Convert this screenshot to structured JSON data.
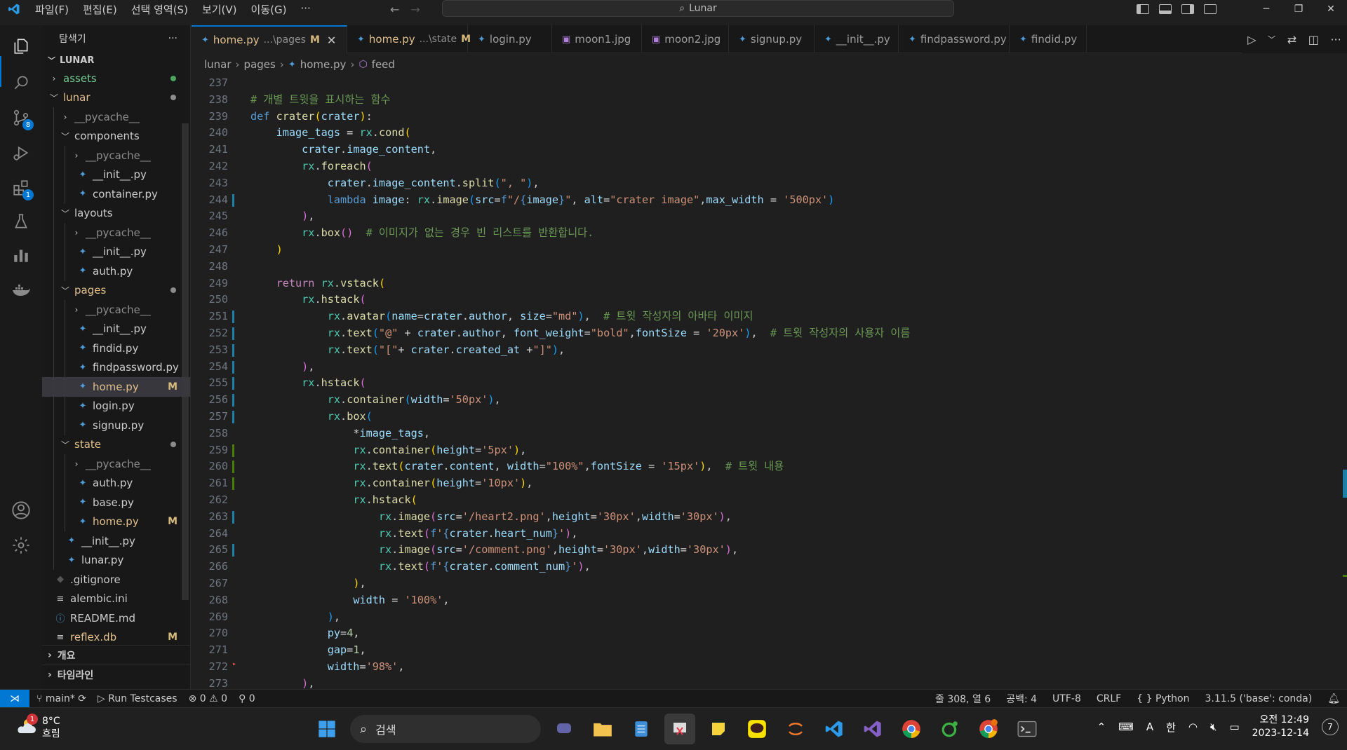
{
  "titlebar": {
    "menu": [
      "파일(F)",
      "편집(E)",
      "선택 영역(S)",
      "보기(V)",
      "이동(G)",
      "···"
    ],
    "search_text": "Lunar"
  },
  "activity": {
    "scm_badge": "8",
    "ext_badge": "1"
  },
  "sidebar": {
    "header": "탐색기",
    "more": "···",
    "root": "LUNAR",
    "items": [
      {
        "label": "assets",
        "indent": 0,
        "type": "folder",
        "open": false,
        "dot": "#4ea35b",
        "color": "#73c991"
      },
      {
        "label": "lunar",
        "indent": 0,
        "type": "folder",
        "open": true,
        "dot": "#8c8c8c",
        "color": "#e2c08d"
      },
      {
        "label": "__pycache__",
        "indent": 1,
        "type": "folder",
        "open": false,
        "color": "#8c8c8c"
      },
      {
        "label": "components",
        "indent": 1,
        "type": "folder",
        "open": true,
        "color": "#cccccc"
      },
      {
        "label": "__pycache__",
        "indent": 2,
        "type": "folder",
        "open": false,
        "color": "#8c8c8c"
      },
      {
        "label": "__init__.py",
        "indent": 2,
        "type": "file",
        "color": "#cccccc"
      },
      {
        "label": "container.py",
        "indent": 2,
        "type": "file",
        "color": "#cccccc"
      },
      {
        "label": "layouts",
        "indent": 1,
        "type": "folder",
        "open": true,
        "color": "#cccccc"
      },
      {
        "label": "__pycache__",
        "indent": 2,
        "type": "folder",
        "open": false,
        "color": "#8c8c8c"
      },
      {
        "label": "__init__.py",
        "indent": 2,
        "type": "file",
        "color": "#cccccc"
      },
      {
        "label": "auth.py",
        "indent": 2,
        "type": "file",
        "color": "#cccccc"
      },
      {
        "label": "pages",
        "indent": 1,
        "type": "folder",
        "open": true,
        "dot": "#8c8c8c",
        "color": "#e2c08d"
      },
      {
        "label": "__pycache__",
        "indent": 2,
        "type": "folder",
        "open": false,
        "color": "#8c8c8c"
      },
      {
        "label": "__init__.py",
        "indent": 2,
        "type": "file",
        "color": "#cccccc"
      },
      {
        "label": "findid.py",
        "indent": 2,
        "type": "file",
        "color": "#cccccc"
      },
      {
        "label": "findpassword.py",
        "indent": 2,
        "type": "file",
        "color": "#cccccc"
      },
      {
        "label": "home.py",
        "indent": 2,
        "type": "file",
        "badge": "M",
        "selected": true,
        "color": "#e2c08d"
      },
      {
        "label": "login.py",
        "indent": 2,
        "type": "file",
        "color": "#cccccc"
      },
      {
        "label": "signup.py",
        "indent": 2,
        "type": "file",
        "color": "#cccccc"
      },
      {
        "label": "state",
        "indent": 1,
        "type": "folder",
        "open": true,
        "dot": "#8c8c8c",
        "color": "#e2c08d"
      },
      {
        "label": "__pycache__",
        "indent": 2,
        "type": "folder",
        "open": false,
        "color": "#8c8c8c"
      },
      {
        "label": "auth.py",
        "indent": 2,
        "type": "file",
        "color": "#cccccc"
      },
      {
        "label": "base.py",
        "indent": 2,
        "type": "file",
        "color": "#cccccc"
      },
      {
        "label": "home.py",
        "indent": 2,
        "type": "file",
        "badge": "M",
        "color": "#e2c08d"
      },
      {
        "label": "__init__.py",
        "indent": 1,
        "type": "file",
        "color": "#cccccc"
      },
      {
        "label": "lunar.py",
        "indent": 1,
        "type": "file",
        "color": "#cccccc"
      },
      {
        "label": ".gitignore",
        "indent": 0,
        "type": "git",
        "color": "#cccccc"
      },
      {
        "label": "alembic.ini",
        "indent": 0,
        "type": "ini",
        "color": "#cccccc"
      },
      {
        "label": "README.md",
        "indent": 0,
        "type": "info",
        "color": "#cccccc"
      },
      {
        "label": "reflex.db",
        "indent": 0,
        "type": "ini",
        "badge": "M",
        "color": "#e2c08d"
      }
    ],
    "outline": "개요",
    "timeline": "타임라인"
  },
  "tabs": [
    {
      "label": "home.py",
      "sub": "...\\pages",
      "mod": "M",
      "active": true,
      "icon": "py",
      "close": "✕"
    },
    {
      "label": "home.py",
      "sub": "...\\state",
      "mod": "M",
      "icon": "py"
    },
    {
      "label": "login.py",
      "icon": "py"
    },
    {
      "label": "moon1.jpg",
      "icon": "img"
    },
    {
      "label": "moon2.jpg",
      "icon": "img"
    },
    {
      "label": "signup.py",
      "icon": "py"
    },
    {
      "label": "__init__.py",
      "icon": "py"
    },
    {
      "label": "findpassword.py",
      "icon": "py"
    },
    {
      "label": "findid.py",
      "icon": "py"
    }
  ],
  "breadcrumb": [
    "lunar",
    "pages",
    "home.py",
    "feed"
  ],
  "code": {
    "lines": [
      {
        "n": "237",
        "html": ""
      },
      {
        "n": "238",
        "html": "<span class=\"com\"># 개별 트윗을 표시하는 함수</span>"
      },
      {
        "n": "239",
        "html": "<span class=\"kw\">def</span> <span class=\"fn\">crater</span><span class=\"br1\">(</span><span class=\"var\">crater</span><span class=\"br1\">)</span>:"
      },
      {
        "n": "240",
        "html": "    <span class=\"var\">image_tags</span> <span class=\"op\">=</span> <span class=\"cls\">rx</span>.<span class=\"fn\">cond</span><span class=\"br1\">(</span>"
      },
      {
        "n": "241",
        "html": "        <span class=\"var\">crater</span>.<span class=\"var\">image_content</span>,"
      },
      {
        "n": "242",
        "html": "        <span class=\"cls\">rx</span>.<span class=\"fn\">foreach</span><span class=\"br2\">(</span>"
      },
      {
        "n": "243",
        "html": "            <span class=\"var\">crater</span>.<span class=\"var\">image_content</span>.<span class=\"fn\">split</span><span class=\"br3\">(</span><span class=\"str\">\", \"</span><span class=\"br3\">)</span>,"
      },
      {
        "n": "244",
        "html": "            <span class=\"kw\">lambda</span> <span class=\"var\">image</span>: <span class=\"cls\">rx</span>.<span class=\"fn\">image</span><span class=\"br3\">(</span><span class=\"var\">src</span><span class=\"op\">=</span><span class=\"kw\">f</span><span class=\"str\">\"/</span><span class=\"kw\">{</span><span class=\"var\">image</span><span class=\"kw\">}</span><span class=\"str\">\"</span>, <span class=\"var\">alt</span><span class=\"op\">=</span><span class=\"str\">\"crater image\"</span>,<span class=\"var\">max_width</span> <span class=\"op\">=</span> <span class=\"str\">'500px'</span><span class=\"br3\">)</span>"
      },
      {
        "n": "245",
        "html": "        <span class=\"br2\">)</span>,"
      },
      {
        "n": "246",
        "html": "        <span class=\"cls\">rx</span>.<span class=\"fn\">box</span><span class=\"br2\">()</span>  <span class=\"com\"># 이미지가 없는 경우 빈 리스트를 반환합니다.</span>"
      },
      {
        "n": "247",
        "html": "    <span class=\"br1\">)</span>"
      },
      {
        "n": "248",
        "html": ""
      },
      {
        "n": "249",
        "html": "    <span class=\"kw2\">return</span> <span class=\"cls\">rx</span>.<span class=\"fn\">vstack</span><span class=\"br1\">(</span>"
      },
      {
        "n": "250",
        "html": "        <span class=\"cls\">rx</span>.<span class=\"fn\">hstack</span><span class=\"br2\">(</span>"
      },
      {
        "n": "251",
        "html": "            <span class=\"cls\">rx</span>.<span class=\"fn\">avatar</span><span class=\"br3\">(</span><span class=\"var\">name</span><span class=\"op\">=</span><span class=\"var\">crater</span>.<span class=\"var\">author</span>, <span class=\"var\">size</span><span class=\"op\">=</span><span class=\"str\">\"md\"</span><span class=\"br3\">)</span>,  <span class=\"com\"># 트윗 작성자의 아바타 이미지</span>"
      },
      {
        "n": "252",
        "html": "            <span class=\"cls\">rx</span>.<span class=\"fn\">text</span><span class=\"br3\">(</span><span class=\"str\">\"@\"</span> <span class=\"op\">+</span> <span class=\"var\">crater</span>.<span class=\"var\">author</span>, <span class=\"var\">font_weight</span><span class=\"op\">=</span><span class=\"str\">\"bold\"</span>,<span class=\"var\">fontSize</span> <span class=\"op\">=</span> <span class=\"str\">'20px'</span><span class=\"br3\">)</span>,  <span class=\"com\"># 트윗 작성자의 사용자 이름</span>"
      },
      {
        "n": "253",
        "html": "            <span class=\"cls\">rx</span>.<span class=\"fn\">text</span><span class=\"br3\">(</span><span class=\"str\">\"[\"</span><span class=\"op\">+</span> <span class=\"var\">crater</span>.<span class=\"var\">created_at</span> <span class=\"op\">+</span><span class=\"str\">\"]\"</span><span class=\"br3\">)</span>,"
      },
      {
        "n": "254",
        "html": "        <span class=\"br2\">)</span>,"
      },
      {
        "n": "255",
        "html": "        <span class=\"cls\">rx</span>.<span class=\"fn\">hstack</span><span class=\"br2\">(</span>"
      },
      {
        "n": "256",
        "html": "            <span class=\"cls\">rx</span>.<span class=\"fn\">container</span><span class=\"br3\">(</span><span class=\"var\">width</span><span class=\"op\">=</span><span class=\"str\">'50px'</span><span class=\"br3\">)</span>,"
      },
      {
        "n": "257",
        "html": "            <span class=\"cls\">rx</span>.<span class=\"fn\">box</span><span class=\"br3\">(</span>"
      },
      {
        "n": "258",
        "html": "                <span class=\"op\">*</span><span class=\"var\">image_tags</span>,"
      },
      {
        "n": "259",
        "html": "                <span class=\"cls\">rx</span>.<span class=\"fn\">container</span><span class=\"br1\">(</span><span class=\"var\">height</span><span class=\"op\">=</span><span class=\"str\">'5px'</span><span class=\"br1\">)</span>,"
      },
      {
        "n": "260",
        "html": "                <span class=\"cls\">rx</span>.<span class=\"fn\">text</span><span class=\"br1\">(</span><span class=\"var\">crater</span>.<span class=\"var\">content</span>, <span class=\"var\">width</span><span class=\"op\">=</span><span class=\"str\">\"100%\"</span>,<span class=\"var\">fontSize</span> <span class=\"op\">=</span> <span class=\"str\">'15px'</span><span class=\"br1\">)</span>,  <span class=\"com\"># 트윗 내용</span>"
      },
      {
        "n": "261",
        "html": "                <span class=\"cls\">rx</span>.<span class=\"fn\">container</span><span class=\"br1\">(</span><span class=\"var\">height</span><span class=\"op\">=</span><span class=\"str\">'10px'</span><span class=\"br1\">)</span>,"
      },
      {
        "n": "262",
        "html": "                <span class=\"cls\">rx</span>.<span class=\"fn\">hstack</span><span class=\"br1\">(</span>"
      },
      {
        "n": "263",
        "html": "                    <span class=\"cls\">rx</span>.<span class=\"fn\">image</span><span class=\"br2\">(</span><span class=\"var\">src</span><span class=\"op\">=</span><span class=\"str\">'/heart2.png'</span>,<span class=\"var\">height</span><span class=\"op\">=</span><span class=\"str\">'30px'</span>,<span class=\"var\">width</span><span class=\"op\">=</span><span class=\"str\">'30px'</span><span class=\"br2\">)</span>,"
      },
      {
        "n": "264",
        "html": "                    <span class=\"cls\">rx</span>.<span class=\"fn\">text</span><span class=\"br2\">(</span><span class=\"kw\">f</span><span class=\"str\">'</span><span class=\"kw\">{</span><span class=\"var\">crater</span>.<span class=\"var\">heart_num</span><span class=\"kw\">}</span><span class=\"str\">'</span><span class=\"br2\">)</span>,"
      },
      {
        "n": "265",
        "html": "                    <span class=\"cls\">rx</span>.<span class=\"fn\">image</span><span class=\"br2\">(</span><span class=\"var\">src</span><span class=\"op\">=</span><span class=\"str\">'/comment.png'</span>,<span class=\"var\">height</span><span class=\"op\">=</span><span class=\"str\">'30px'</span>,<span class=\"var\">width</span><span class=\"op\">=</span><span class=\"str\">'30px'</span><span class=\"br2\">)</span>,"
      },
      {
        "n": "266",
        "html": "                    <span class=\"cls\">rx</span>.<span class=\"fn\">text</span><span class=\"br2\">(</span><span class=\"kw\">f</span><span class=\"str\">'</span><span class=\"kw\">{</span><span class=\"var\">crater</span>.<span class=\"var\">comment_num</span><span class=\"kw\">}</span><span class=\"str\">'</span><span class=\"br2\">)</span>,"
      },
      {
        "n": "267",
        "html": "                <span class=\"br1\">)</span>,"
      },
      {
        "n": "268",
        "html": "                <span class=\"var\">width</span> <span class=\"op\">=</span> <span class=\"str\">'100%'</span>,"
      },
      {
        "n": "269",
        "html": "            <span class=\"br3\">)</span>,"
      },
      {
        "n": "270",
        "html": "            <span class=\"var\">py</span><span class=\"op\">=</span><span class=\"num\">4</span>,"
      },
      {
        "n": "271",
        "html": "            <span class=\"var\">gap</span><span class=\"op\">=</span><span class=\"num\">1</span>,"
      },
      {
        "n": "272",
        "html": "            <span class=\"var\">width</span><span class=\"op\">=</span><span class=\"str\">'98%'</span>,"
      },
      {
        "n": "273",
        "html": "        <span class=\"br2\">)</span>,"
      }
    ]
  },
  "status": {
    "branch": "main*",
    "run": "Run Testcases",
    "errors": "0",
    "warnings": "0",
    "ports": "0",
    "position": "줄 308, 열 6",
    "spaces": "공백: 4",
    "encoding": "UTF-8",
    "eol": "CRLF",
    "language": "Python",
    "interpreter": "3.11.5 ('base': conda)"
  },
  "taskbar": {
    "weather_temp": "8°C",
    "weather_desc": "흐림",
    "weather_badge": "1",
    "search": "검색",
    "ime_a": "A",
    "ime_lang": "한",
    "time": "오전 12:49",
    "date": "2023-12-14",
    "notifications": "7"
  }
}
